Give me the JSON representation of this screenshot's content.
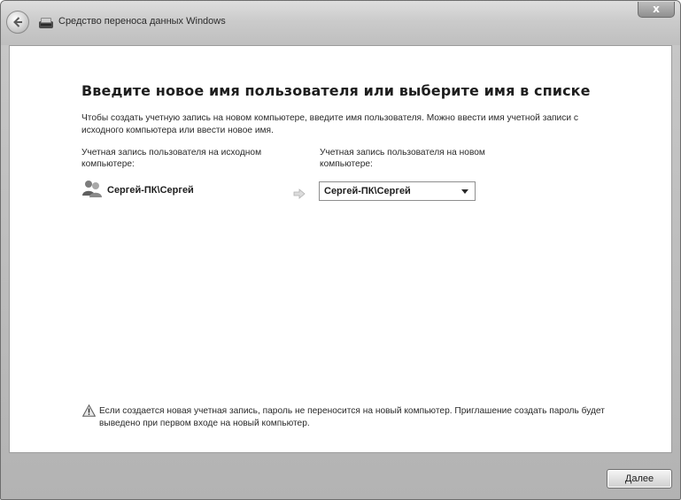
{
  "window": {
    "title": "Средство переноса данных Windows",
    "close_label": "x"
  },
  "main": {
    "heading": "Введите новое имя пользователя или выберите имя в списке",
    "description": "Чтобы создать учетную запись на новом компьютере, введите имя пользователя. Можно ввести имя учетной записи с исходного компьютера или ввести новое имя.",
    "source": {
      "label": "Учетная запись пользователя на исходном компьютере:",
      "user": "Сергей-ПК\\Сергей",
      "icon": "users-icon"
    },
    "destination": {
      "label": "Учетная запись пользователя на новом компьютере:",
      "selected": "Сергей-ПК\\Сергей",
      "icon": "chevron-down-icon"
    },
    "warning": {
      "icon": "warning-icon",
      "text": "Если создается новая учетная запись, пароль не переносится на новый компьютер. Приглашение создать пароль будет выведено при первом входе на новый компьютер."
    }
  },
  "footer": {
    "next_label": "Далее"
  }
}
